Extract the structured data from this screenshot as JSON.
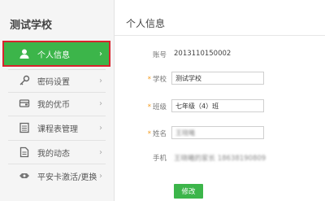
{
  "sidebar": {
    "school_name": "测试学校",
    "items": [
      {
        "label": "个人信息",
        "icon": "user-icon",
        "active": true
      },
      {
        "label": "密码设置",
        "icon": "key-icon",
        "active": false
      },
      {
        "label": "我的优币",
        "icon": "coin-icon",
        "active": false
      },
      {
        "label": "课程表管理",
        "icon": "schedule-icon",
        "active": false
      },
      {
        "label": "我的动态",
        "icon": "activity-icon",
        "active": false
      },
      {
        "label": "平安卡激活/更换",
        "icon": "card-icon",
        "active": false
      }
    ],
    "chevron": "›"
  },
  "main": {
    "title": "个人信息",
    "fields": {
      "account": {
        "label": "账号",
        "value": "2013110150002"
      },
      "school": {
        "label": "学校",
        "value": "测试学校",
        "required": true
      },
      "class": {
        "label": "班级",
        "value": "七年级（4）班",
        "required": true
      },
      "name": {
        "label": "姓名",
        "value": "王晓曦",
        "required": true
      },
      "phone": {
        "label": "手机",
        "value": "王晓曦的家长  18638190809"
      }
    },
    "required_mark": "*",
    "submit_label": "修改"
  },
  "colors": {
    "accent": "#3cb54a",
    "highlight": "#d9232d",
    "required": "#f39a1e"
  }
}
